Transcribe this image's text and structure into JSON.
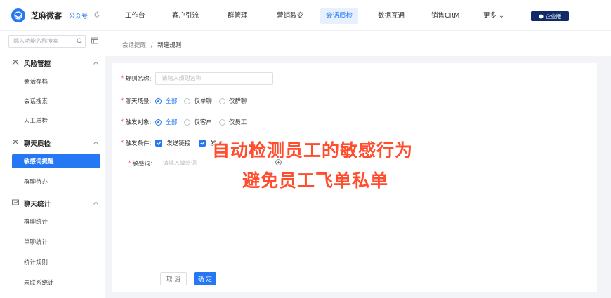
{
  "header": {
    "brand_name": "芝麻微客",
    "brand_tag": "公众号",
    "nav": [
      {
        "label": "工作台"
      },
      {
        "label": "客户引流"
      },
      {
        "label": "群管理"
      },
      {
        "label": "营销裂变"
      },
      {
        "label": "会话质检"
      },
      {
        "label": "数据互通"
      },
      {
        "label": "销售CRM"
      },
      {
        "label": "更多 ⌄"
      }
    ],
    "active_nav": "会话质检",
    "enterprise_label": "企业版"
  },
  "sidebar": {
    "search_placeholder": "输入功能名称搜索",
    "groups": [
      {
        "label": "风险管控",
        "items": [
          "会话存档",
          "会话搜索",
          "人工质检"
        ]
      },
      {
        "label": "聊天质检",
        "items": [
          "敏感词提醒",
          "群聊待办"
        ]
      },
      {
        "label": "聊天统计",
        "items": [
          "群聊统计",
          "单聊统计",
          "统计规则",
          "未联系统计"
        ]
      }
    ],
    "active_item": "敏感词提醒"
  },
  "breadcrumb": {
    "parent": "会话提醒",
    "separator": "/",
    "current": "新建规则"
  },
  "form": {
    "rule_name": {
      "label": "规则名称:",
      "placeholder": "请输入规则名称"
    },
    "chat_scene": {
      "label": "聊天场景:",
      "options": [
        "全部",
        "仅单聊",
        "仅群聊"
      ],
      "selected": "全部"
    },
    "trigger_target": {
      "label": "触发对象:",
      "options": [
        "全部",
        "仅客户",
        "仅员工"
      ],
      "selected": "全部"
    },
    "trigger_condition": {
      "label": "触发条件:",
      "options": [
        "发送链接",
        "发"
      ]
    },
    "sensitive_word": {
      "label": "敏感词:",
      "placeholder": "请输入敏感词"
    }
  },
  "footer": {
    "cancel_label": "取 消",
    "ok_label": "确 定"
  },
  "overlay": {
    "line1": "自动检测员工的敏感行为",
    "line2": "避免员工飞单私单"
  },
  "colors": {
    "primary": "#2577f4",
    "overlay": "#ff4d2d",
    "enterprise": "#0f2a66"
  }
}
